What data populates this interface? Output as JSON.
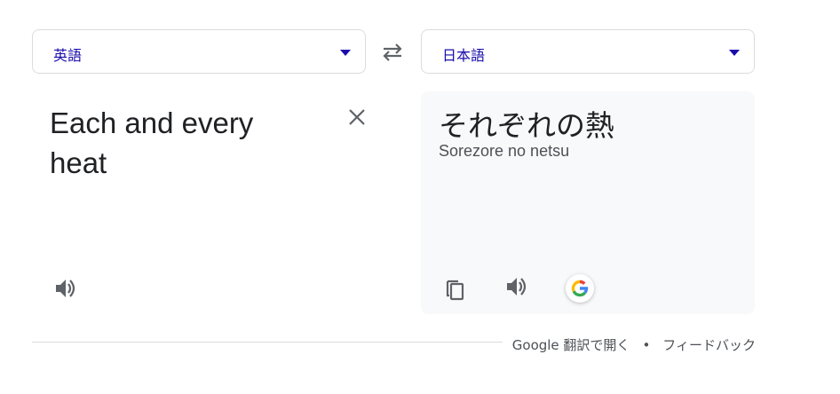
{
  "source_language": {
    "label": "英語"
  },
  "target_language": {
    "label": "日本語"
  },
  "source": {
    "text": "Each and every heat"
  },
  "target": {
    "text": "それぞれの熱",
    "romanization": "Sorezore no netsu"
  },
  "footer": {
    "open_link": "Google 翻訳で開く",
    "separator": "•",
    "feedback_link": "フィードバック"
  },
  "icons": {
    "swap": "swap-arrows-icon",
    "clear": "close-icon",
    "speak": "speaker-icon",
    "copy": "copy-icon",
    "google": "google-g-logo-icon"
  },
  "colors": {
    "accent": "#1a0dab",
    "icon": "#5f6368",
    "panel": "#f8f9fa"
  }
}
